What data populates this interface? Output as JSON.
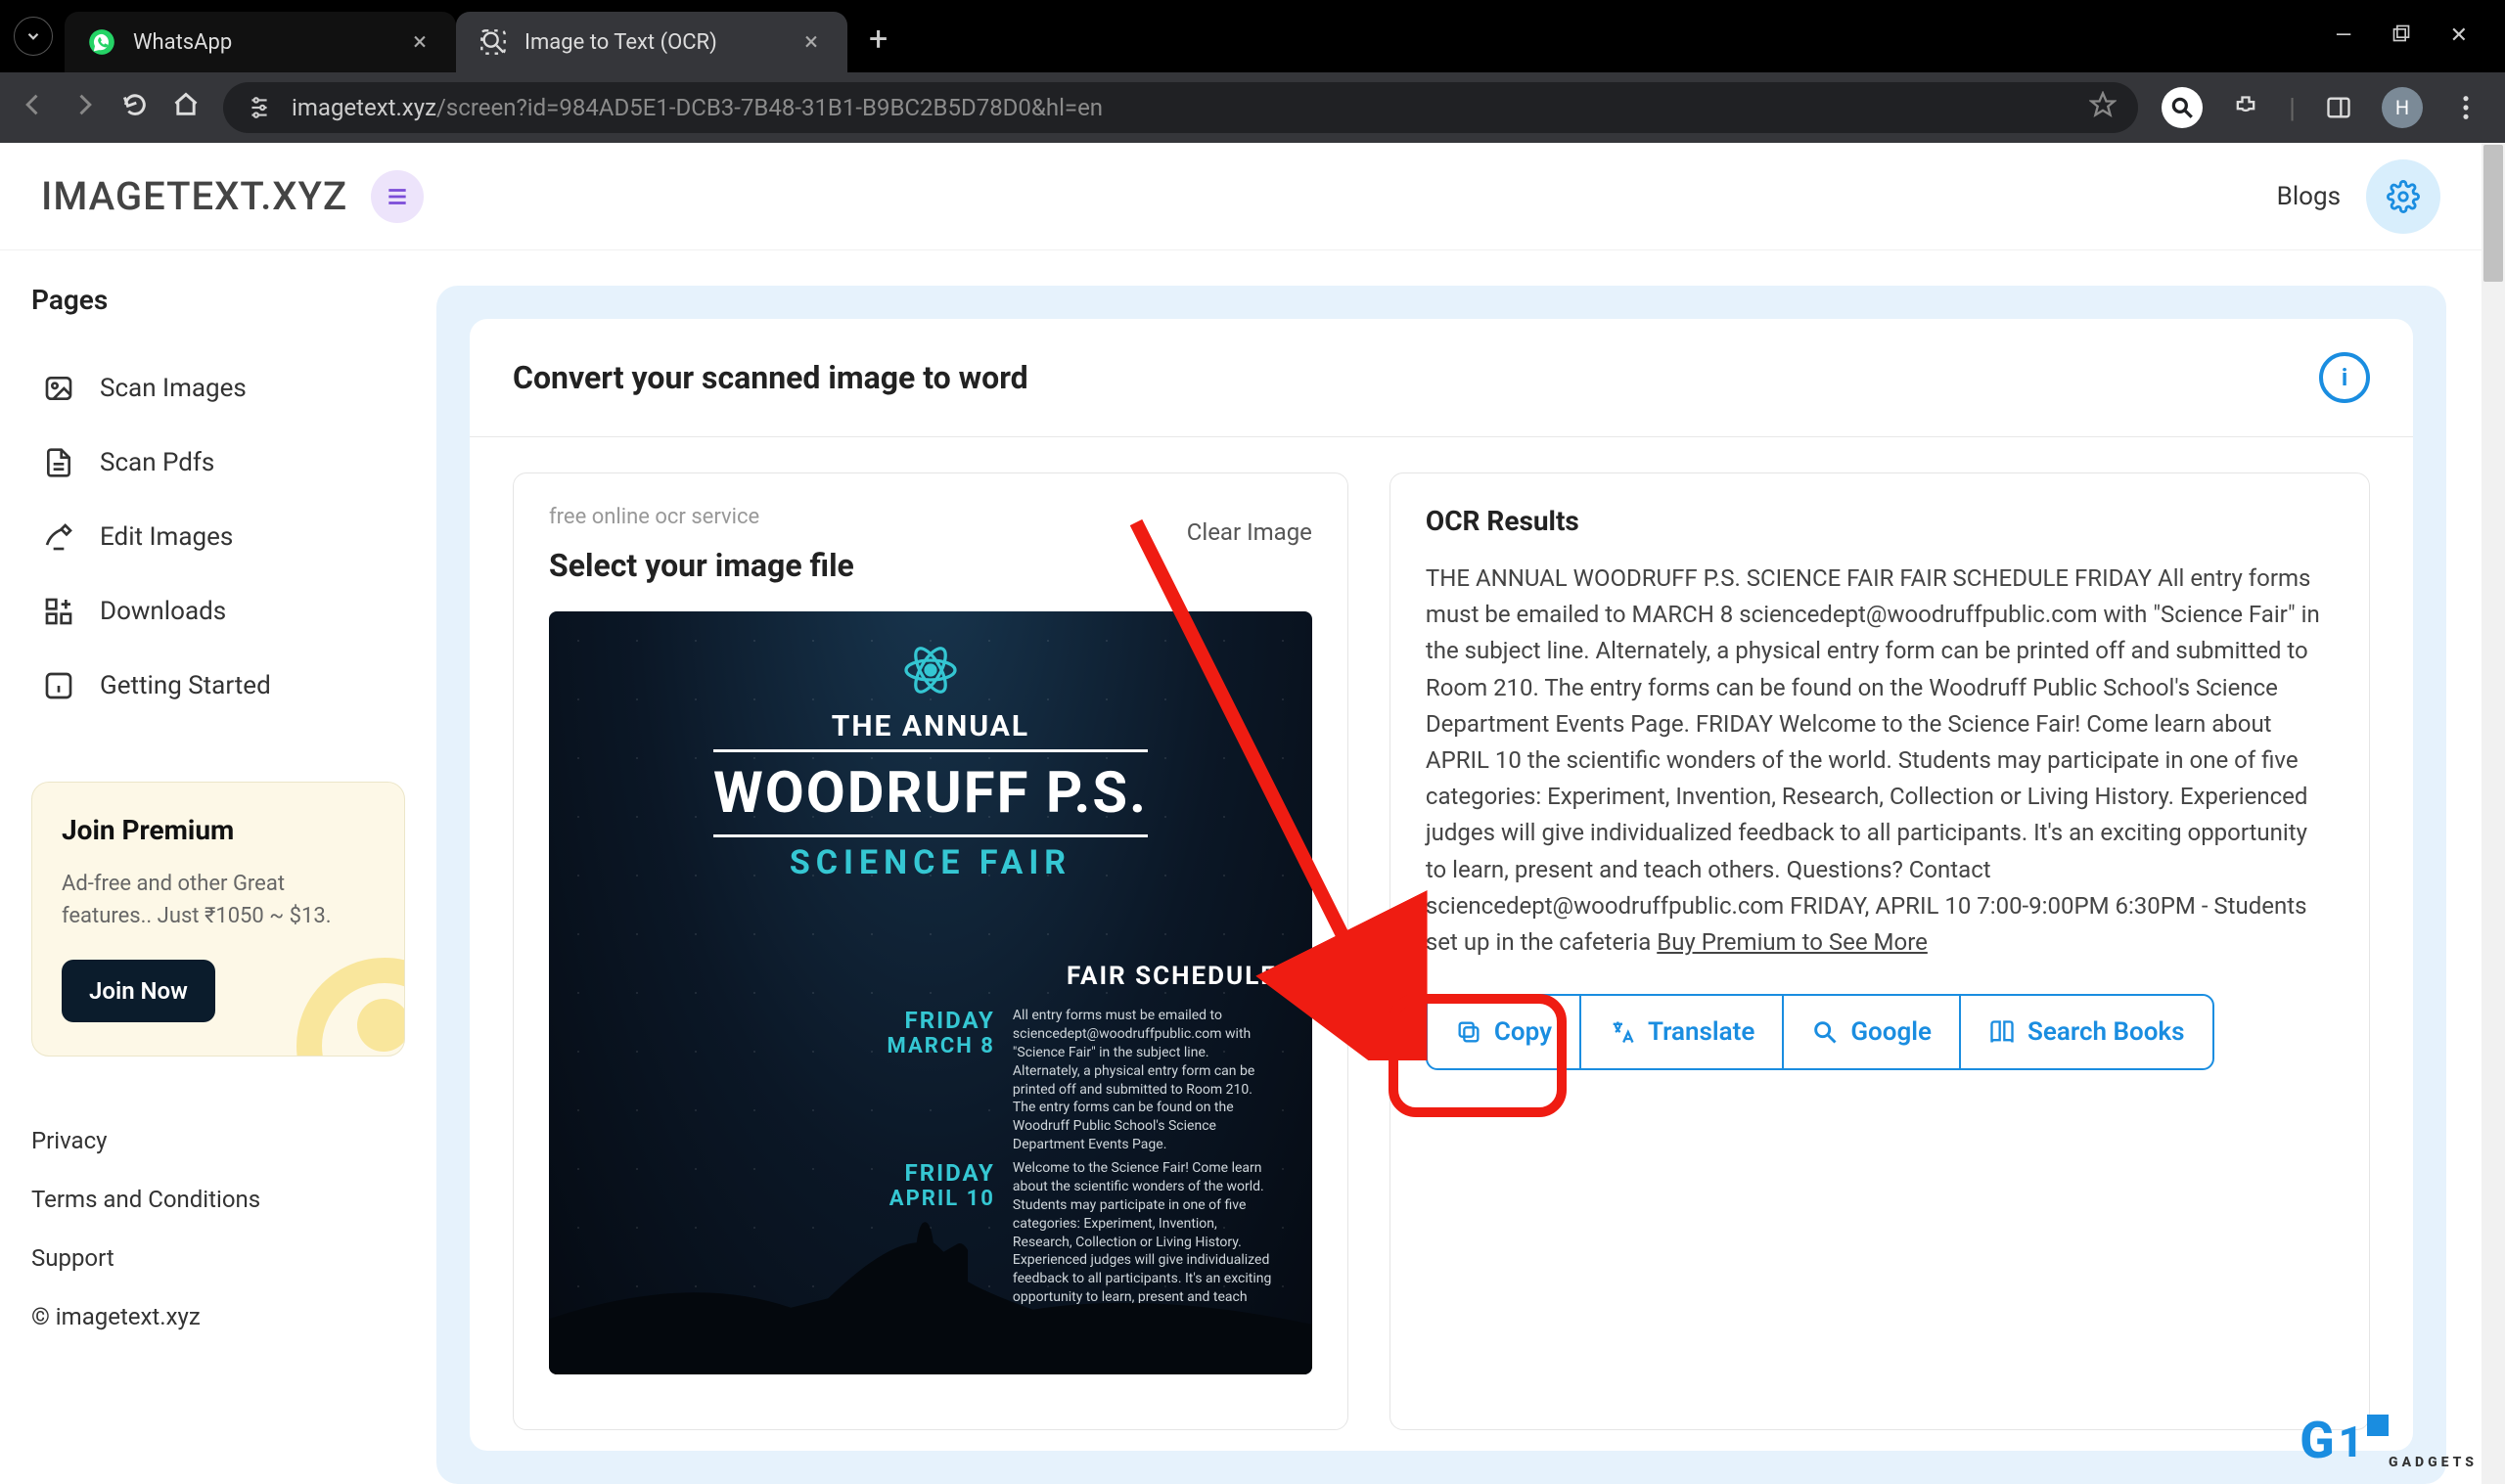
{
  "browser": {
    "tabs": [
      {
        "title": "WhatsApp",
        "active": false,
        "favicon": "whatsapp"
      },
      {
        "title": "Image to Text (OCR)",
        "active": true,
        "favicon": "ocr"
      }
    ],
    "url_host": "imagetext.xyz",
    "url_path": "/screen?id=984AD5E1-DCB3-7B48-31B1-B9BC2B5D78D0&hl=en",
    "avatar_initial": "H"
  },
  "app": {
    "logo": "IMAGETEXT.XYZ",
    "nav_blogs": "Blogs"
  },
  "sidebar": {
    "title": "Pages",
    "items": [
      {
        "label": "Scan Images"
      },
      {
        "label": "Scan Pdfs"
      },
      {
        "label": "Edit Images"
      },
      {
        "label": "Downloads"
      },
      {
        "label": "Getting Started"
      }
    ],
    "premium": {
      "title": "Join Premium",
      "subtitle": "Ad-free and other Great features.. Just ₹1050 ~ $13.",
      "cta": "Join Now"
    },
    "footer": [
      "Privacy",
      "Terms and Conditions",
      "Support",
      "© imagetext.xyz"
    ]
  },
  "main": {
    "heading": "Convert your scanned image to word",
    "left": {
      "hint": "free online ocr service",
      "title": "Select your image file",
      "clear": "Clear Image"
    },
    "poster": {
      "line1": "THE ANNUAL",
      "line2": "WOODRUFF P.S.",
      "line3": "SCIENCE FAIR",
      "sched_title": "FAIR SCHEDULE",
      "date1a": "FRIDAY",
      "date1b": "MARCH 8",
      "desc1": "All entry forms must be emailed to sciencedept@woodruffpublic.com with \"Science Fair\" in the subject line. Alternately, a physical entry form can be printed off and submitted to Room 210. The entry forms can be found on the Woodruff Public School's Science Department Events Page.",
      "date2a": "FRIDAY",
      "date2b": "APRIL 10",
      "desc2": "Welcome to the Science Fair! Come learn about the scientific wonders of the world. Students may participate in one of five categories: Experiment, Invention, Research, Collection or Living History. Experienced judges will give individualized feedback to all participants. It's an exciting opportunity to learn, present and teach others."
    },
    "ocr": {
      "title": "OCR Results",
      "text": "THE ANNUAL WOODRUFF P.S. SCIENCE FAIR FAIR SCHEDULE FRIDAY All entry forms must be emailed to MARCH 8 sciencedept@woodruffpublic.com with \"Science Fair\" in the subject line. Alternately, a physical entry form can be printed off and submitted to Room 210. The entry forms can be found on the Woodruff Public School's Science Department Events Page. FRIDAY Welcome to the Science Fair! Come learn about APRIL 10 the scientific wonders of the world. Students may participate in one of five categories: Experiment, Invention, Research, Collection or Living History. Experienced judges will give individualized feedback to all participants. It's an exciting opportunity to learn, present and teach others. Questions? Contact sciencedept@woodruffpublic.com FRIDAY, APRIL 10 7:00-9:00PM 6:30PM - Students set up in the cafeteria",
      "premium_link": "Buy Premium to See More",
      "actions": {
        "copy": "Copy",
        "translate": "Translate",
        "google": "Google",
        "search_books": "Search Books"
      }
    }
  },
  "watermark": {
    "brand": "G",
    "sub": "GADGETS"
  }
}
